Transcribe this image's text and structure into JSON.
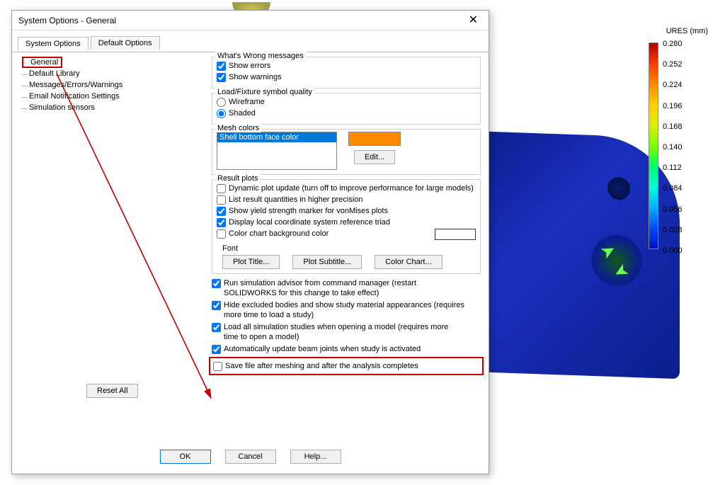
{
  "dialog": {
    "title": "System Options - General",
    "tabs": [
      "System Options",
      "Default Options"
    ],
    "active_tab": 0,
    "tree": [
      "General",
      "Default Library",
      "Messages/Errors/Warnings",
      "Email Notification Settings",
      "Simulation sensors"
    ],
    "reset_label": "Reset All",
    "ok_label": "OK",
    "cancel_label": "Cancel",
    "help_label": "Help..."
  },
  "whats_wrong": {
    "title": "What's Wrong messages",
    "show_errors": "Show errors",
    "show_warnings": "Show warnings"
  },
  "load_fixture": {
    "title": "Load/Fixture symbol quality",
    "wireframe": "Wireframe",
    "shaded": "Shaded"
  },
  "mesh_colors": {
    "title": "Mesh colors",
    "item": "Shell bottom face color",
    "edit": "Edit..."
  },
  "result_plots": {
    "title": "Result plots",
    "dynamic": "Dynamic plot update (turn off to improve performance for large models)",
    "list_precision": "List result quantities in higher precision",
    "yield_marker": "Show yield strength marker for vonMises plots",
    "local_triad": "Display local coordinate system reference triad",
    "color_bg": "Color chart background color",
    "font_label": "Font",
    "plot_title": "Plot Title...",
    "plot_subtitle": "Plot Subtitle...",
    "color_chart": "Color Chart..."
  },
  "extra": {
    "advisor": "Run simulation advisor from command manager (restart SOLIDWORKS for this change to take effect)",
    "hide_excluded": "Hide excluded bodies and show study material appearances (requires more time to load a study)",
    "load_all": "Load all simulation studies when opening a model (requires more time to open a model)",
    "auto_beam": "Automatically update beam joints when study is activated",
    "save_after": "Save file after meshing and after the analysis completes"
  },
  "legend": {
    "title": "URES (mm)",
    "ticks": [
      "0.280",
      "0.252",
      "0.224",
      "0.196",
      "0.168",
      "0.140",
      "0.112",
      "0.084",
      "0.056",
      "0.028",
      "0.000"
    ]
  }
}
